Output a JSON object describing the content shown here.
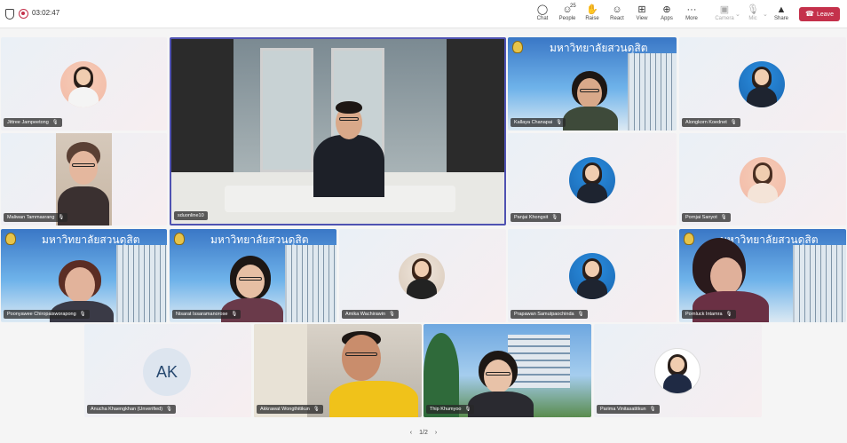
{
  "topbar": {
    "timer": "03:02:47",
    "people_count": "25",
    "buttons": {
      "chat": "Chat",
      "people": "People",
      "raise": "Raise",
      "react": "React",
      "view": "View",
      "apps": "Apps",
      "more": "More",
      "camera": "Camera",
      "mic": "Mic",
      "share": "Share"
    },
    "leave": "Leave"
  },
  "banner_text": "มหาวิทยาลัยสวนดุสิต",
  "participants": [
    {
      "name": "Jittree Jampeetong"
    },
    {
      "name": "sduonline10"
    },
    {
      "name": "Kallaya Chanapai"
    },
    {
      "name": "Alongkorn Koednet"
    },
    {
      "name": "Maliwan Tammasrang"
    },
    {
      "name": "Panjai Khongsit"
    },
    {
      "name": "Pornjai Sanyot"
    },
    {
      "name": "Poonyawee Chiropaisworapong"
    },
    {
      "name": "Nisarat Issaramanorose"
    },
    {
      "name": "Amika Wachirawin"
    },
    {
      "name": "Prapawan Samutpaochinda"
    },
    {
      "name": "Pornluck Intamra"
    },
    {
      "name": "Anucha Khaengkhan (Unverified)",
      "initials": "AK"
    },
    {
      "name": "Akkrawat Wongthitikun"
    },
    {
      "name": "Thip Khumyoo"
    },
    {
      "name": "Parima Vinitasatitkun"
    }
  ],
  "pager": {
    "label": "1/2"
  },
  "colors": {
    "leave": "#c4314b",
    "tile_bg": "#eaf0f6",
    "active_border": "#4f52b2"
  },
  "icons": [
    "shield-icon",
    "record-icon",
    "chat-icon",
    "people-icon",
    "hand-icon",
    "smile-icon",
    "grid-icon",
    "apps-icon",
    "more-icon",
    "camera-off-icon",
    "mic-off-icon",
    "share-icon",
    "phone-icon",
    "mic-muted-icon",
    "chevron-left-icon",
    "chevron-right-icon"
  ]
}
